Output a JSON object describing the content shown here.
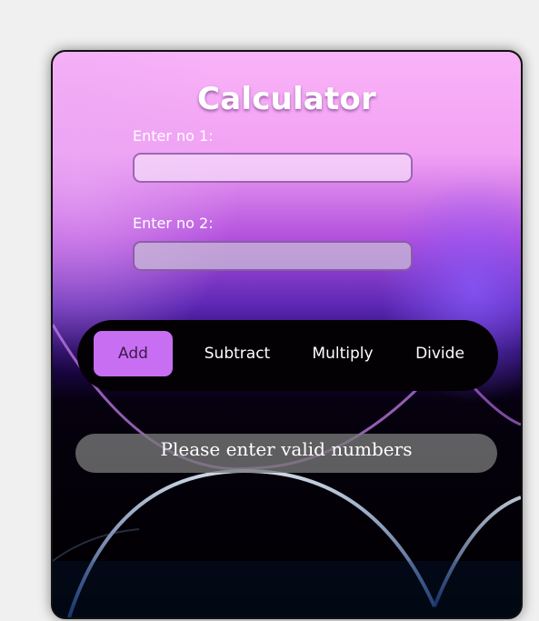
{
  "calculator": {
    "title": "Calculator",
    "label_no1": "Enter no 1:",
    "label_no2": "Enter no 2:",
    "input_no1_value": "",
    "input_no2_value": "",
    "operations": {
      "add": "Add",
      "subtract": "Subtract",
      "multiply": "Multiply",
      "divide": "Divide"
    },
    "result_text": "Please enter valid numbers"
  },
  "colors": {
    "accent": "#c86ef2",
    "page_background": "#f0f0f0"
  }
}
